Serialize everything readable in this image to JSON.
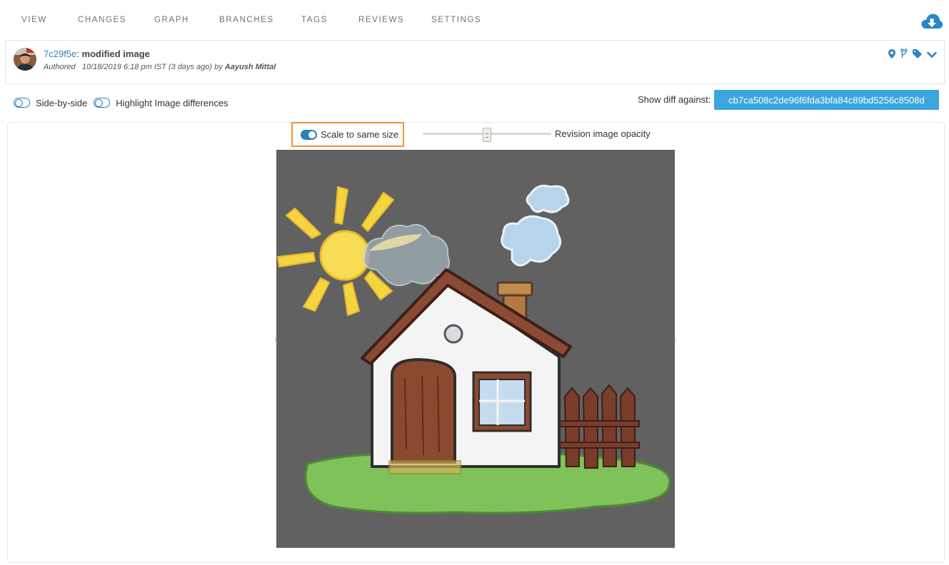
{
  "nav": {
    "tabs": [
      {
        "label": "VIEW"
      },
      {
        "label": "CHANGES"
      },
      {
        "label": "GRAPH"
      },
      {
        "label": "BRANCHES"
      },
      {
        "label": "TAGS"
      },
      {
        "label": "REVIEWS"
      },
      {
        "label": "SETTINGS"
      }
    ],
    "download_icon": "cloud-download-icon"
  },
  "commit": {
    "hash": "7c29f5e",
    "separator": ":",
    "message": "modified image",
    "authored_label": "Authored",
    "date": "10/18/2019 6:18 pm IST (3 days ago) by",
    "author": "Aayush Mittal",
    "icons": [
      "map-marker-icon",
      "branch-icon",
      "tag-icon",
      "chevron-down-icon"
    ]
  },
  "options": {
    "side_by_side": "Side-by-side",
    "highlight_differences": "Highlight Image differences",
    "show_diff_label": "Show diff against:",
    "diff_hash": "cb7ca508c2de96f6fda3bfa84c89bd5256c8508d"
  },
  "viewer": {
    "scale_label": "Scale to same size",
    "scale_enabled": true,
    "opacity_label": "Revision image opacity",
    "opacity_value": 0.5,
    "image_background": "#616161"
  },
  "colors": {
    "accent": "#2f84c2",
    "button": "#3aa6dd",
    "highlight_box": "#f0913a"
  }
}
